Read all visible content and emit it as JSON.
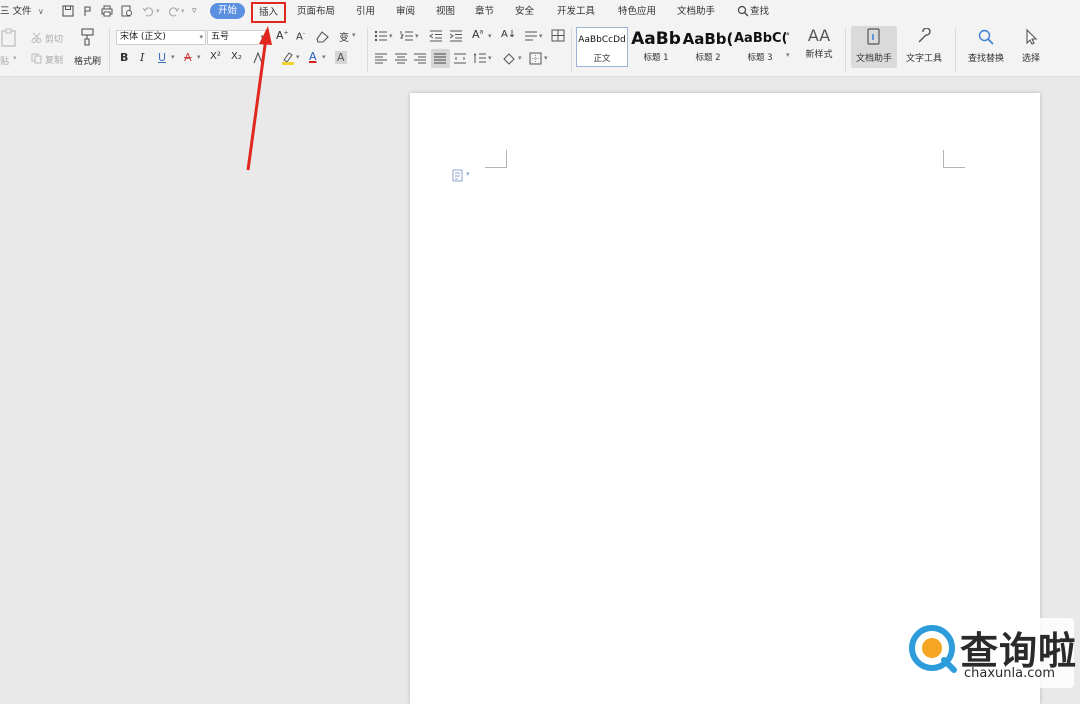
{
  "menu": {
    "file": "三 文件",
    "start": "开始",
    "insert": "插入",
    "tabs": [
      {
        "label": "页面布局"
      },
      {
        "label": "引用"
      },
      {
        "label": "审阅"
      },
      {
        "label": "视图"
      },
      {
        "label": "章节"
      },
      {
        "label": "安全"
      },
      {
        "label": "开发工具"
      },
      {
        "label": "特色应用"
      },
      {
        "label": "文档助手"
      }
    ],
    "search": "查找"
  },
  "ribbon": {
    "paste": "贴",
    "cut": "剪切",
    "copy": "复制",
    "format_painter": "格式刷",
    "font_name": "宋体 (正文)",
    "font_size": "五号",
    "bold": "B",
    "italic": "I",
    "underline": "U",
    "strike": "A",
    "superscript": "X²",
    "subscript": "X₂",
    "font_color": "A",
    "char_shade": "A",
    "styles": [
      {
        "preview": "AaBbCcDd",
        "label": "正文"
      },
      {
        "preview": "AaBb",
        "label": "标题 1"
      },
      {
        "preview": "AaBb(",
        "label": "标题 2"
      },
      {
        "preview": "AaBbC(",
        "label": "标题 3"
      }
    ],
    "new_style": "新样式",
    "doc_assistant": "文档助手",
    "text_tools": "文字工具",
    "find_replace": "查找替换",
    "select": "选择"
  },
  "watermark": {
    "brand": "查询啦",
    "url": "chaxunla.com"
  },
  "colors": {
    "accent": "#5b8fe0",
    "highlight_red": "#e0281e"
  }
}
